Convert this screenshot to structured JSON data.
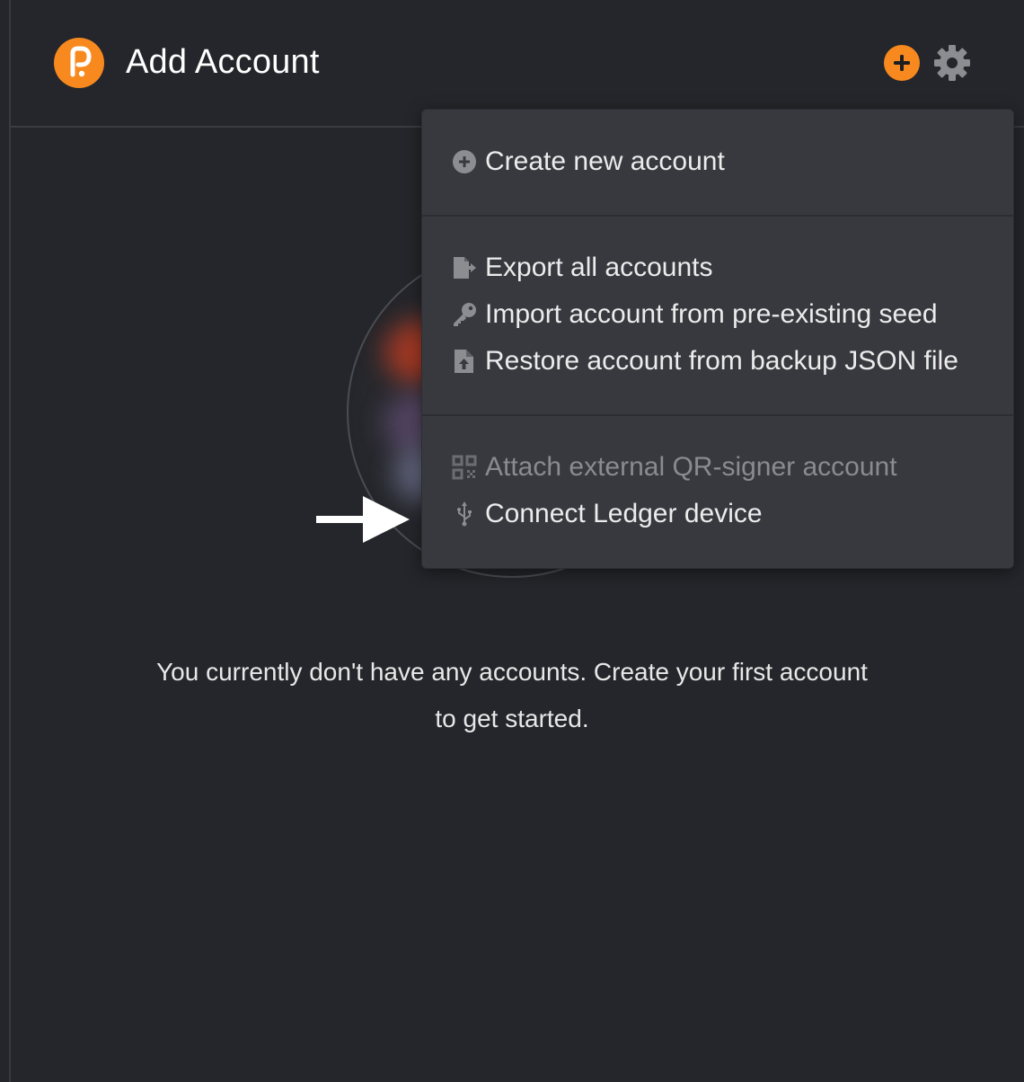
{
  "header": {
    "title": "Add Account"
  },
  "menu": {
    "groups": [
      {
        "items": [
          {
            "label": "Create new account",
            "icon": "plus-circle-icon",
            "enabled": true
          }
        ]
      },
      {
        "items": [
          {
            "label": "Export all accounts",
            "icon": "file-export-icon",
            "enabled": true
          },
          {
            "label": "Import account from pre-existing seed",
            "icon": "key-icon",
            "enabled": true
          },
          {
            "label": "Restore account from backup JSON file",
            "icon": "file-upload-icon",
            "enabled": true
          }
        ]
      },
      {
        "items": [
          {
            "label": "Attach external QR-signer account",
            "icon": "qrcode-icon",
            "enabled": false
          },
          {
            "label": "Connect Ledger device",
            "icon": "usb-icon",
            "enabled": true
          }
        ]
      }
    ]
  },
  "main": {
    "empty_message": "You currently don't have any accounts. Create your first account to get started."
  },
  "colors": {
    "accent": "#f7891f",
    "background": "#25262b",
    "menu_background": "#38393f",
    "disabled_text": "#8a8b90"
  }
}
